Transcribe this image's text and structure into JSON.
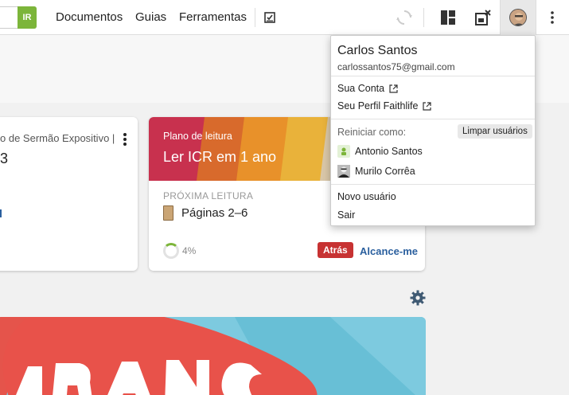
{
  "topbar": {
    "search_button": "IR",
    "nav": [
      "Documentos",
      "Guias",
      "Ferramentas"
    ],
    "icons": [
      "checklist-icon",
      "sync-icon",
      "layout-icon",
      "popout-icon",
      "user-avatar",
      "more-vert-icon"
    ]
  },
  "cards": {
    "left": {
      "title": "o de Sermão Expositivo | Je",
      "number": "3"
    },
    "plan": {
      "label": "Plano de leitura",
      "title": "Ler ICR em 1 ano",
      "next_label": "PRÓXIMA LEITURA",
      "pages": "Páginas 2–6",
      "progress_text": "4%",
      "progress": 0.04,
      "behind_label": "Atrás",
      "catchup_label": "Alcance-me"
    }
  },
  "menu": {
    "name": "Carlos Santos",
    "email": "carlossantos75@gmail.com",
    "account": "Sua Conta",
    "profile": "Seu Perfil Faithlife",
    "switch_label": "Reiniciar como:",
    "clear_button": "Limpar usuários",
    "users": [
      {
        "name": "Antonio Santos"
      },
      {
        "name": "Murilo Corrêa"
      }
    ],
    "new_user": "Novo usuário",
    "logout": "Sair"
  },
  "colors": {
    "accent_green": "#7cb53a",
    "link_blue": "#2a5f9e",
    "behind_red": "#c73232"
  }
}
